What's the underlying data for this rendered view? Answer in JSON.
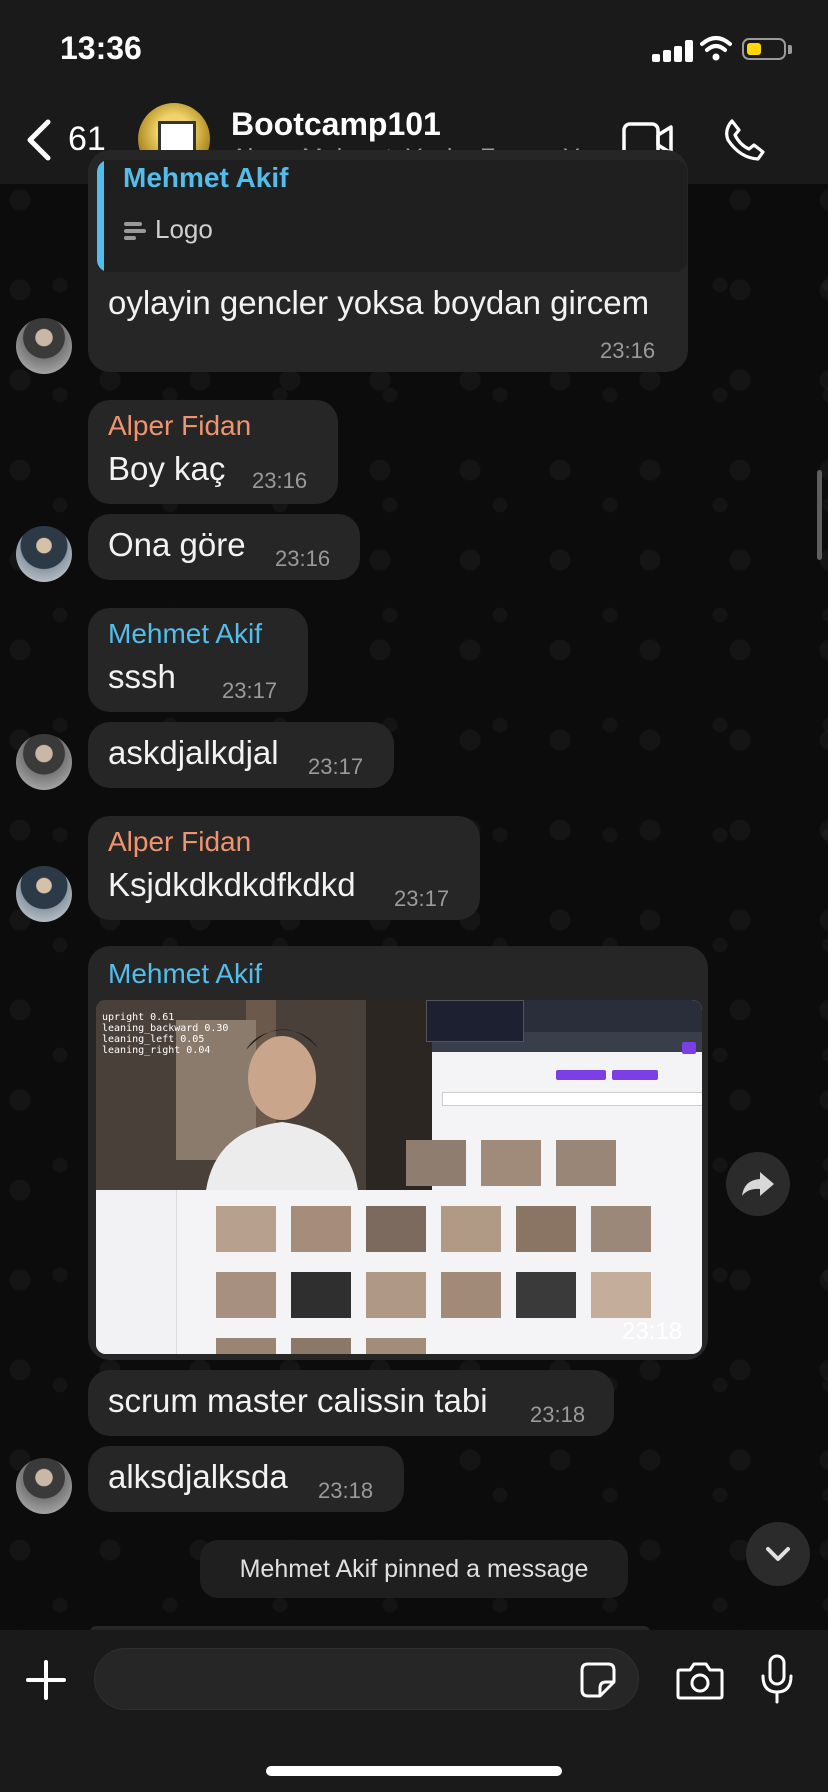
{
  "status": {
    "time": "13:36"
  },
  "header": {
    "back_count": "61",
    "title": "Bootcamp101",
    "subtitle": "Alper, Mehmet, Yasin, Zozan, Y..."
  },
  "quote": {
    "sender": "Mehmet Akif",
    "text": "Logo"
  },
  "messages": [
    {
      "text": "oylayin gencler yoksa boydan gircem",
      "time": "23:16"
    },
    {
      "sender": "Alper Fidan",
      "text": "Boy kaç",
      "time": "23:16"
    },
    {
      "text": "Ona göre",
      "time": "23:16"
    },
    {
      "sender": "Mehmet Akif",
      "text": "sssh",
      "time": "23:17"
    },
    {
      "text": "askdjalkdjal",
      "time": "23:17"
    },
    {
      "sender": "Alper Fidan",
      "text": "Ksjdkdkdkdfkdkd",
      "time": "23:17"
    },
    {
      "sender": "Mehmet Akif",
      "time": "23:18",
      "image_overlay": [
        "upright 0.61",
        "leaning_backward 0.30",
        "leaning_left 0.05",
        "leaning_right 0.04"
      ]
    },
    {
      "text": "scrum master calissin tabi",
      "time": "23:18"
    },
    {
      "text": "alksdjalksda",
      "time": "23:18"
    }
  ],
  "system_message": "Mehmet Akif pinned a message",
  "composer": {
    "placeholder": ""
  },
  "colors": {
    "accent_blue": "#53bdeb",
    "accent_orange": "#f0946d",
    "battery": "#ffd60a"
  }
}
